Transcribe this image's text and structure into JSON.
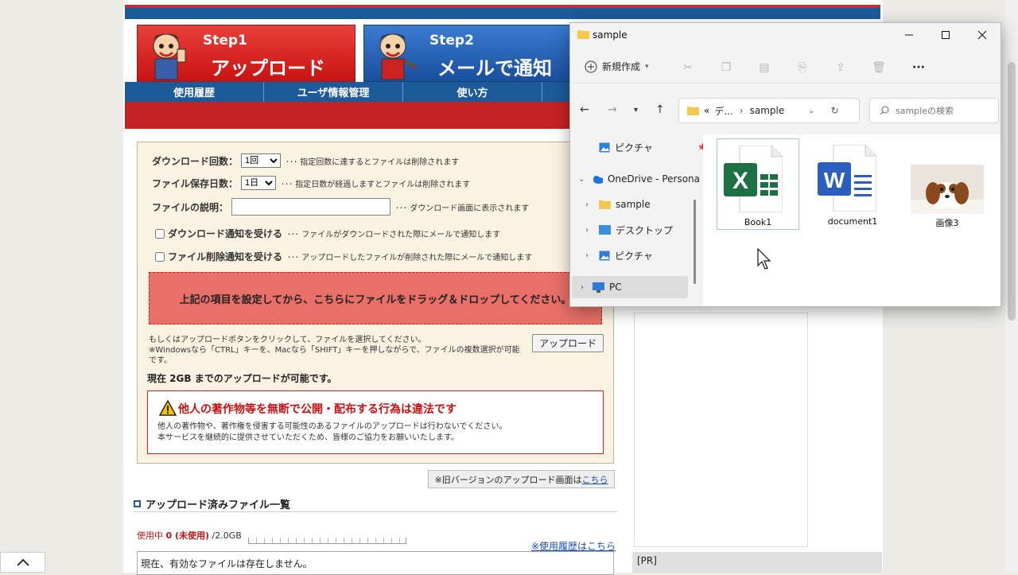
{
  "site": {
    "steps": [
      {
        "label": "Step1",
        "big": "アップロード"
      },
      {
        "label": "Step2",
        "big": "メールで通知"
      }
    ],
    "nav": [
      "使用履歴",
      "ユーザ情報管理",
      "使い方"
    ],
    "form": {
      "download_count_label": "ダウンロード回数：",
      "download_count_value": "1回",
      "download_count_note": "･･･ 指定回数に達するとファイルは削除されます",
      "keep_days_label": "ファイル保存日数：",
      "keep_days_value": "1日",
      "keep_days_note": "･･･ 指定日数が経過しますとファイルは削除されます",
      "desc_label": "ファイルの説明：",
      "desc_note": "･･･ ダウンロード画面に表示されます",
      "dl_notify_label": "ダウンロード通知を受ける",
      "dl_notify_note": "･･･ ファイルがダウンロードされた際にメールで通知します",
      "del_notify_label": "ファイル削除通知を受ける",
      "del_notify_note": "･･･ アップロードしたファイルが削除された際にメールで通知します"
    },
    "dropzone": "上記の項目を設定してから、こちらにファイルをドラッグ＆ドロップしてください。",
    "help_line1": "もしくはアップロードボタンをクリックして、ファイルを選択してください。",
    "help_line2": "※Windowsなら「CTRL」キーを、Macなら「SHIFT」キーを押しながらで、ファイルの複数選択が可能です。",
    "upload_button": "アップロード",
    "capacity": "現在 2GB までのアップロードが可能です。",
    "warning_title": "他人の著作物等を無断で公開・配布する行為は違法です",
    "warning_body1": "他人の著作物や、著作権を侵害する可能性のあるファイルのアップロードは行わないでください。",
    "warning_body2": "本サービスを継続的に提供させていただくため、皆様のご協力をお願いいたします。",
    "old_version_text": "※旧バージョンのアップロード画面は",
    "old_version_link": "こちら",
    "section_title": "アップロード済みファイル一覧",
    "usage_prefix": "使用中 ",
    "usage_value": "0 (未使用)",
    "usage_total": " /2.0GB",
    "usage_fraction": 0,
    "history_link": "※使用履歴はこちら",
    "files_empty": "現在、有効なファイルは存在しません。",
    "pr": "[PR]"
  },
  "explorer": {
    "title": "sample",
    "new_button": "新規作成",
    "address_prefix": "«",
    "address_parent": "デ...",
    "address_current": "sample",
    "search_placeholder": "sampleの検索",
    "nav": [
      {
        "label": "ピクチャ",
        "icon": "pictures-icon"
      },
      {
        "label": "OneDrive - Persona",
        "icon": "onedrive-icon"
      },
      {
        "label": "sample",
        "icon": "folder-icon"
      },
      {
        "label": "デスクトップ",
        "icon": "desktop-icon"
      },
      {
        "label": "ピクチャ",
        "icon": "pictures-icon"
      },
      {
        "label": "PC",
        "icon": "pc-icon"
      }
    ],
    "files": [
      {
        "name": "Book1",
        "type": "excel"
      },
      {
        "name": "document1",
        "type": "word"
      },
      {
        "name": "画像3",
        "type": "image"
      }
    ]
  },
  "colors": {
    "brand_blue": "#1d5a9a",
    "brand_red": "#c81313",
    "excel": "#1d7044",
    "word": "#2b5ebd"
  }
}
